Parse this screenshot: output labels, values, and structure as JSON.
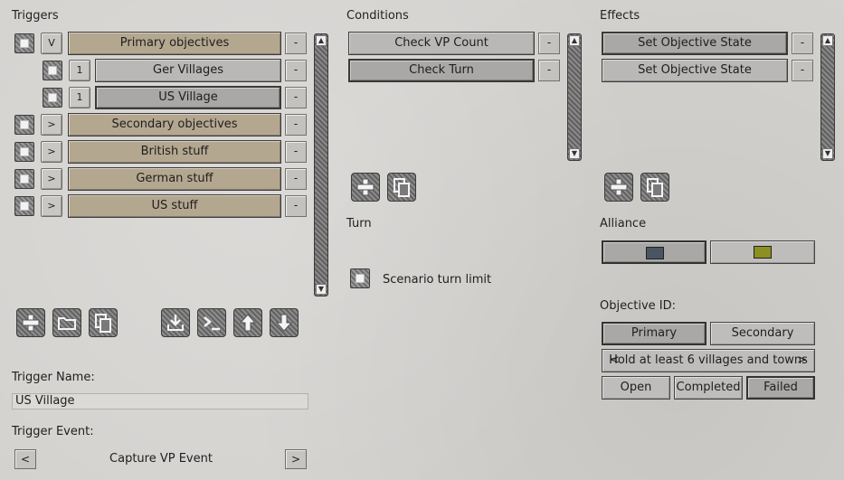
{
  "triggers": {
    "header": "Triggers",
    "rows": [
      {
        "toggle": "V",
        "label": "Primary objectives",
        "color": "tan"
      },
      {
        "toggle": "1",
        "label": "Ger Villages",
        "color": "grey"
      },
      {
        "toggle": "1",
        "label": "US Village",
        "color": "grey",
        "selected": true
      },
      {
        "toggle": ">",
        "label": "Secondary objectives",
        "color": "tan"
      },
      {
        "toggle": ">",
        "label": "British stuff",
        "color": "tan"
      },
      {
        "toggle": ">",
        "label": "German stuff",
        "color": "tan"
      },
      {
        "toggle": ">",
        "label": "US stuff",
        "color": "tan"
      }
    ],
    "remove_label": "-",
    "toolbar": [
      "add-icon",
      "folder-icon",
      "copy-icon",
      "import-icon",
      "console-icon",
      "arrow-up-icon",
      "arrow-down-icon"
    ],
    "name_label": "Trigger Name:",
    "name_value": "US Village",
    "event_label": "Trigger Event:",
    "event_value": "Capture VP Event",
    "prev": "<",
    "next": ">"
  },
  "conditions": {
    "header": "Conditions",
    "items": [
      "Check VP Count",
      "Check Turn"
    ],
    "remove_label": "-",
    "toolbar": [
      "add-icon",
      "copy-icon"
    ],
    "turn_header": "Turn",
    "turn_option": "Scenario turn limit"
  },
  "effects": {
    "header": "Effects",
    "items": [
      "Set Objective State",
      "Set Objective State"
    ],
    "remove_label": "-",
    "toolbar": [
      "add-icon",
      "copy-icon"
    ],
    "alliance_header": "Alliance",
    "alliance_colors": [
      "#4a5561",
      "#8c9020"
    ],
    "objective_header": "Objective ID:",
    "objective_types": [
      "Primary",
      "Secondary"
    ],
    "objective_text": "Hold at least 6 villages and towns",
    "objective_prev": "<",
    "objective_next": ">",
    "states": [
      "Open",
      "Completed",
      "Failed"
    ]
  }
}
